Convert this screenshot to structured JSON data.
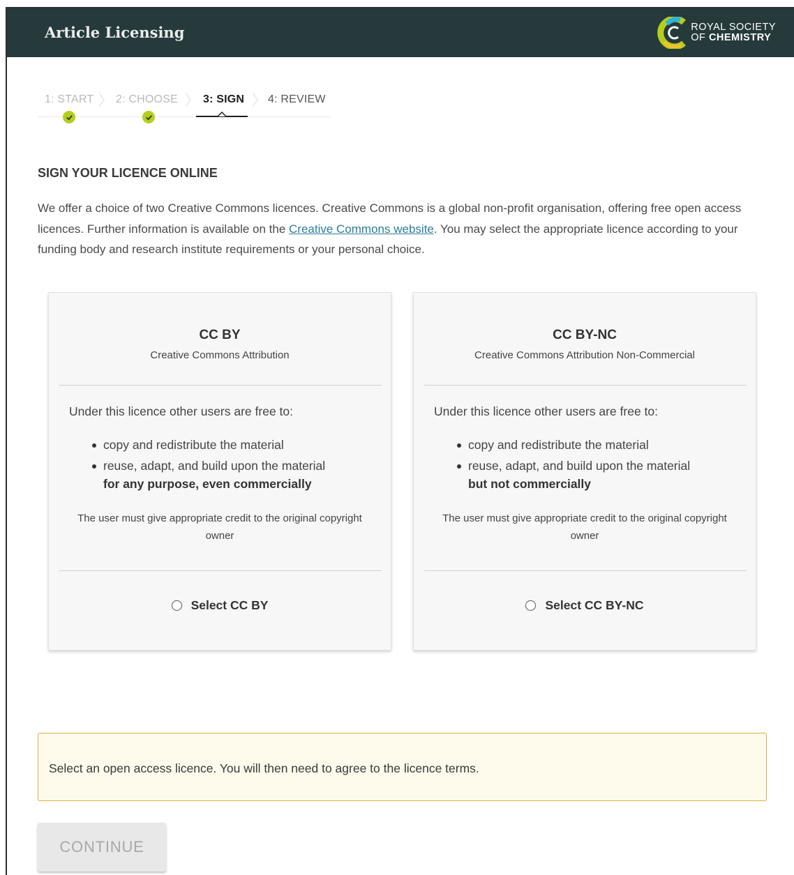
{
  "header": {
    "title": "Article Licensing",
    "logo_line1": "ROYAL SOCIETY",
    "logo_line2_prefix": "OF ",
    "logo_line2_bold": "CHEMISTRY"
  },
  "steps": [
    {
      "label": "1: START",
      "state": "completed"
    },
    {
      "label": "2: CHOOSE",
      "state": "completed"
    },
    {
      "label": "3: SIGN",
      "state": "active"
    },
    {
      "label": "4: REVIEW",
      "state": "upcoming"
    }
  ],
  "section": {
    "title": "SIGN YOUR LICENCE ONLINE",
    "intro_part1": "We offer a choice of two Creative Commons licences. Creative Commons is a global non-profit organisation, offering free open access licences. Further information is available on the ",
    "intro_link": "Creative Commons website",
    "intro_part2": ". You may select the appropriate licence according to your funding body and research institute requirements or your personal choice."
  },
  "cards": [
    {
      "title": "CC BY",
      "subtitle": "Creative Commons Attribution",
      "lead": "Under this licence other users are free to:",
      "items": [
        "copy and redistribute the material",
        "reuse, adapt, and build upon the material"
      ],
      "emphasis": "for any purpose, even commercially",
      "credit": "The user must give appropriate credit to the original copyright owner",
      "select_label": "Select CC BY",
      "selected": false
    },
    {
      "title": "CC BY-NC",
      "subtitle": "Creative Commons Attribution Non-Commercial",
      "lead": "Under this licence other users are free to:",
      "items": [
        "copy and redistribute the material",
        "reuse, adapt, and build upon the material"
      ],
      "emphasis": "but not commercially",
      "credit": "The user must give appropriate credit to the original copyright owner",
      "select_label": "Select CC BY-NC",
      "selected": false
    }
  ],
  "notice": {
    "text": "Select an open access licence. You will then need to agree to the licence terms."
  },
  "continue_button": {
    "label": "CONTINUE",
    "enabled": false
  },
  "colors": {
    "header_bg": "#263a3c",
    "step_check": "#b5ce1e",
    "link": "#2e7c9c",
    "notice_bg": "#fefaec",
    "notice_border": "#d8b043"
  }
}
